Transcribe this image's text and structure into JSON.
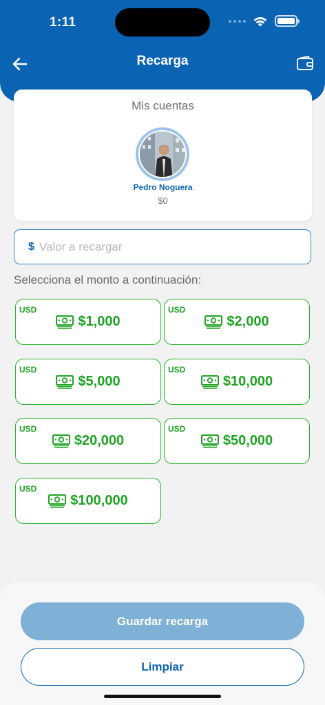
{
  "status_bar": {
    "time": "1:11"
  },
  "header": {
    "title": "Recarga"
  },
  "accounts": {
    "title": "Mis cuentas",
    "account": {
      "name": "Pedro Noguera",
      "balance": "$0"
    }
  },
  "amount_input": {
    "currency": "$",
    "placeholder": "Valor a recargar",
    "value": ""
  },
  "select_label": "Selecciona el monto a continuación:",
  "amount_options": [
    {
      "currency": "USD",
      "amount": "$1,000"
    },
    {
      "currency": "USD",
      "amount": "$2,000"
    },
    {
      "currency": "USD",
      "amount": "$5,000"
    },
    {
      "currency": "USD",
      "amount": "$10,000"
    },
    {
      "currency": "USD",
      "amount": "$20,000"
    },
    {
      "currency": "USD",
      "amount": "$50,000"
    },
    {
      "currency": "USD",
      "amount": "$100,000"
    }
  ],
  "actions": {
    "save_label": "Guardar recarga",
    "clear_label": "Limpiar"
  },
  "colors": {
    "primary": "#0a63b3",
    "success_green": "#1fa324",
    "disabled_button": "#7fb1d6",
    "background": "#f2f2f2"
  },
  "icons": [
    "back-arrow-icon",
    "wallet-icon",
    "cash-icon",
    "wifi-icon",
    "battery-icon"
  ]
}
